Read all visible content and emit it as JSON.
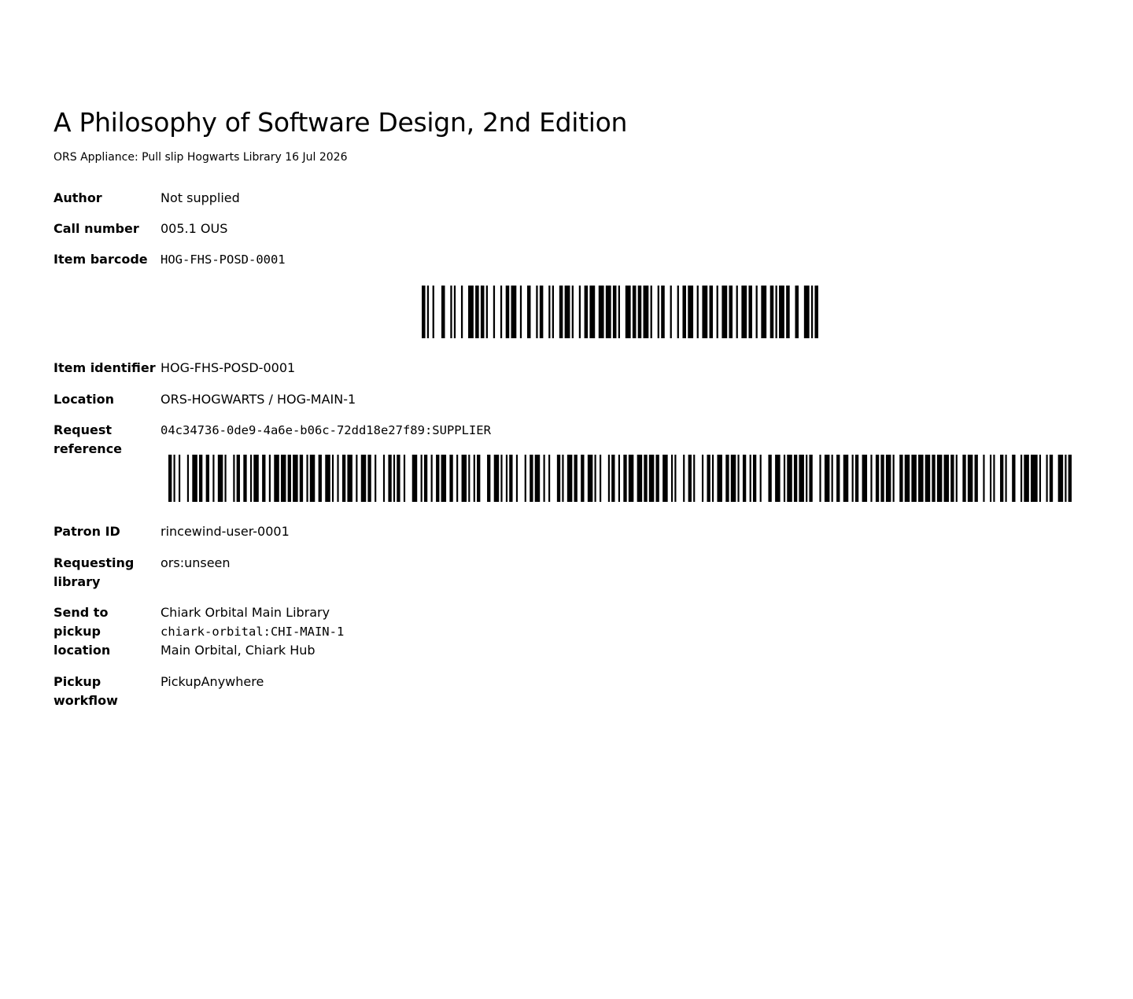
{
  "title": "A Philosophy of Software Design, 2nd Edition",
  "subtitle": "ORS Appliance: Pull slip Hogwarts Library 16 Jul 2026",
  "fields": {
    "author": {
      "label": "Author",
      "value": "Not supplied"
    },
    "call_number": {
      "label": "Call number",
      "value": "005.1 OUS"
    },
    "item_barcode": {
      "label": "Item barcode",
      "value": "HOG-FHS-POSD-0001"
    },
    "item_identifier": {
      "label": "Item identifier",
      "value": "HOG-FHS-POSD-0001"
    },
    "location": {
      "label": "Location",
      "value": "ORS-HOGWARTS / HOG-MAIN-1"
    },
    "request_reference": {
      "label": "Request reference",
      "value": "04c34736-0de9-4a6e-b06c-72dd18e27f89:SUPPLIER"
    },
    "patron_id": {
      "label": "Patron ID",
      "value": "rincewind-user-0001"
    },
    "requesting_library": {
      "label": "Requesting library",
      "value": "ors:unseen"
    },
    "pickup_location": {
      "label": "Send to pickup location",
      "name": "Chiark Orbital Main Library",
      "code": "chiark-orbital:CHI-MAIN-1",
      "address": "Main Orbital, Chiark Hub"
    },
    "pickup_workflow": {
      "label": "Pickup workflow",
      "value": "PickupAnywhere"
    }
  },
  "barcodes": {
    "item": {
      "encodes": "HOG-FHS-POSD-0001",
      "bar_color": "#000000"
    },
    "request": {
      "encodes": "04c34736-0de9-4a6e-b06c-72dd18e27f89:SUPPLIER",
      "bar_color": "#000000"
    }
  }
}
